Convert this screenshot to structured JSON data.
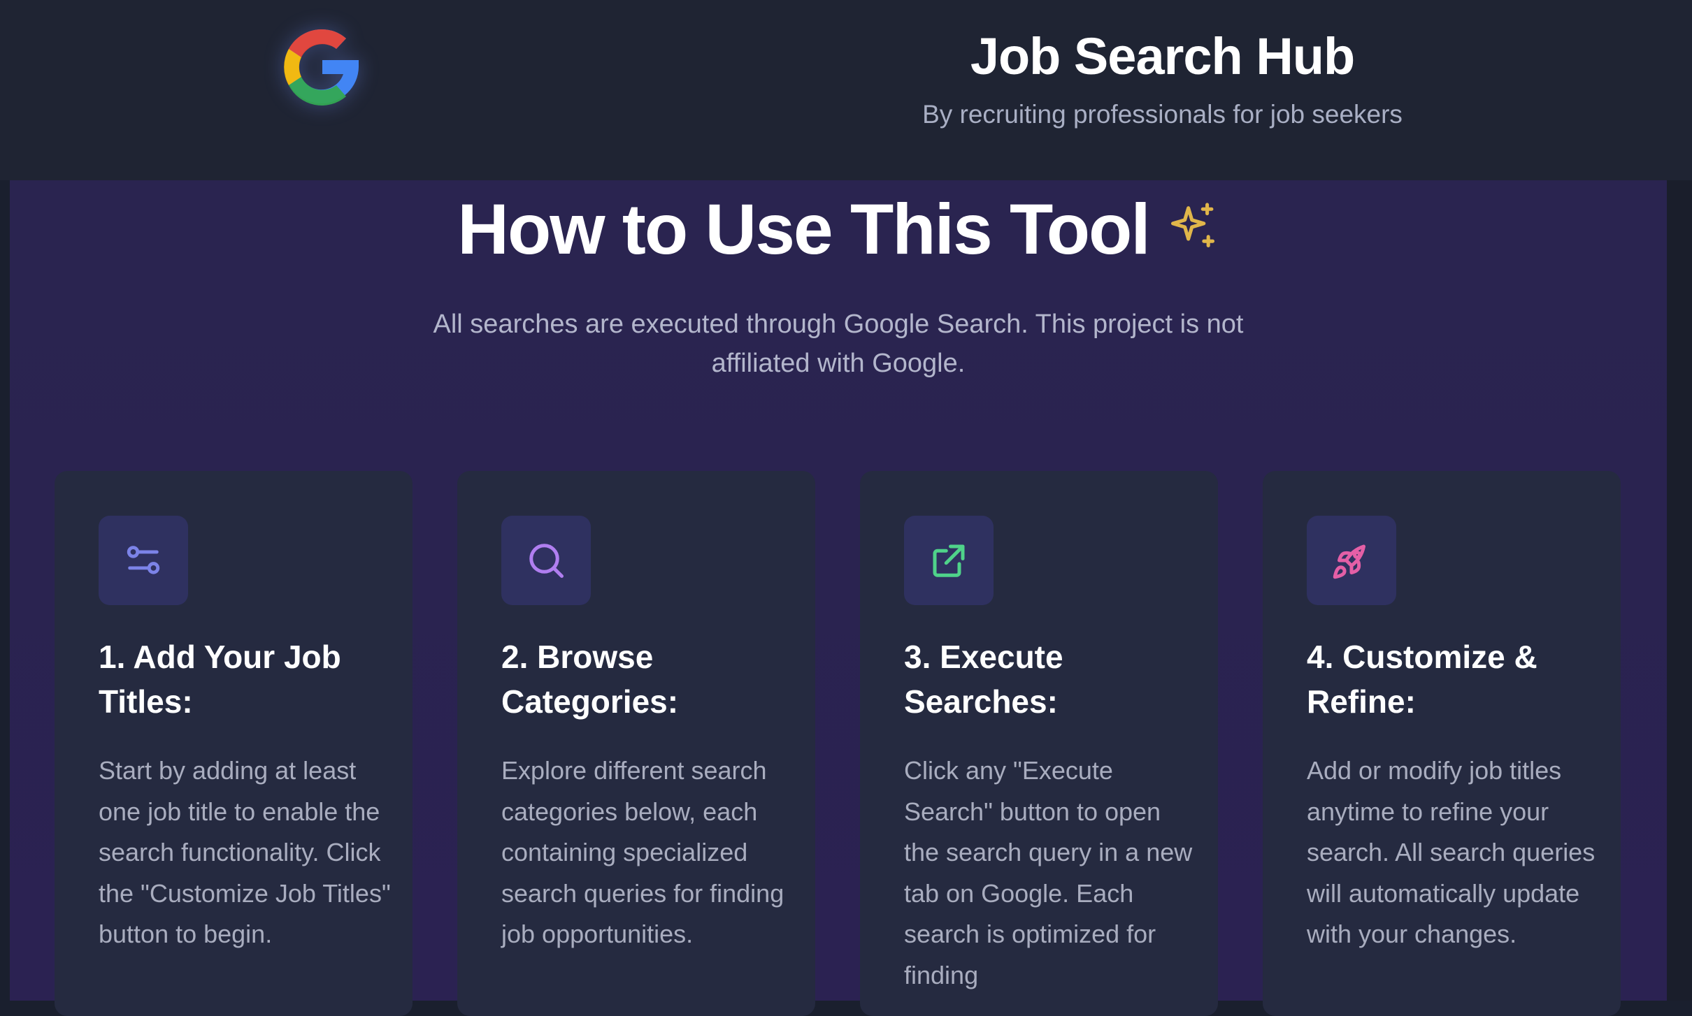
{
  "header": {
    "logo_icon": "google-g-logo-icon",
    "title": "Job Search Hub",
    "subtitle": "By recruiting professionals for job seekers"
  },
  "hero": {
    "title": "How to Use This Tool",
    "title_icon": "sparkles-icon",
    "description": "All searches are executed through Google Search. This project is not affiliated with Google."
  },
  "steps": [
    {
      "icon": "sliders-icon",
      "icon_color": "#7c83e8",
      "title": "1. Add Your Job Titles:",
      "text": "Start by adding at least one job title to enable the search functionality. Click the \"Customize Job Titles\" button to begin."
    },
    {
      "icon": "search-icon",
      "icon_color": "#b07ef0",
      "title": "2. Browse Categories:",
      "text": "Explore different search categories below, each containing specialized search queries for finding job opportunities."
    },
    {
      "icon": "external-link-icon",
      "icon_color": "#4fd38a",
      "title": "3. Execute Searches:",
      "text": "Click any \"Execute Search\" button to open the search query in a new tab on Google. Each search is optimized for finding"
    },
    {
      "icon": "rocket-icon",
      "icon_color": "#e45fa6",
      "title": "4. Customize & Refine:",
      "text": "Add or modify job titles anytime to refine your search. All search queries will automatically update with your changes."
    }
  ],
  "colors": {
    "header_bg": "#1f2433",
    "main_bg": "#2a2450",
    "card_bg": "#252a40",
    "icon_box_bg": "#2f3160",
    "sparkle": "#e0b64a"
  }
}
